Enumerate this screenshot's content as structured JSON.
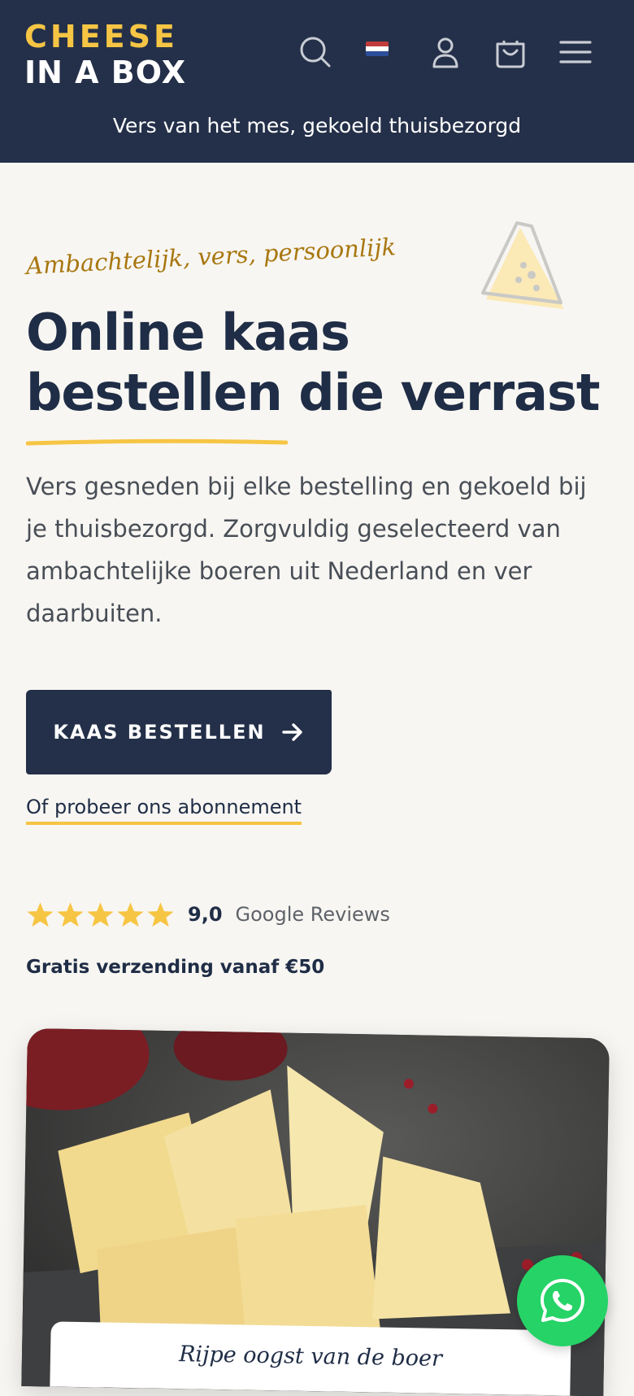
{
  "brand": {
    "line1": "CHEESE",
    "line2": "IN A BOX"
  },
  "header": {
    "tagline": "Vers van het mes, gekoeld thuisbezorgd",
    "icons": [
      "search-icon",
      "nl-flag",
      "account-icon",
      "cart-icon",
      "menu-icon"
    ]
  },
  "hero": {
    "kicker": "Ambachtelijk, vers, persoonlijk",
    "title": "Online kaas bestellen die verrast",
    "description": "Vers gesneden bij elke bestelling en gekoeld bij je thuisbezorgd. Zorgvuldig geselecteerd van ambachtelijke boeren uit Nederland en ver daarbuiten.",
    "cta_label": "KAAS BESTELLEN",
    "subscription_link": "Of probeer ons abonnement"
  },
  "rating": {
    "stars": 5,
    "score": "9,0",
    "source": "Google Reviews"
  },
  "shipping_note": "Gratis verzending vanaf €50",
  "photo": {
    "caption": "Rijpe oogst van de boer"
  },
  "colors": {
    "navy": "#243049",
    "yellow": "#f6c544",
    "background": "#f8f6f2",
    "whatsapp": "#25d366"
  }
}
